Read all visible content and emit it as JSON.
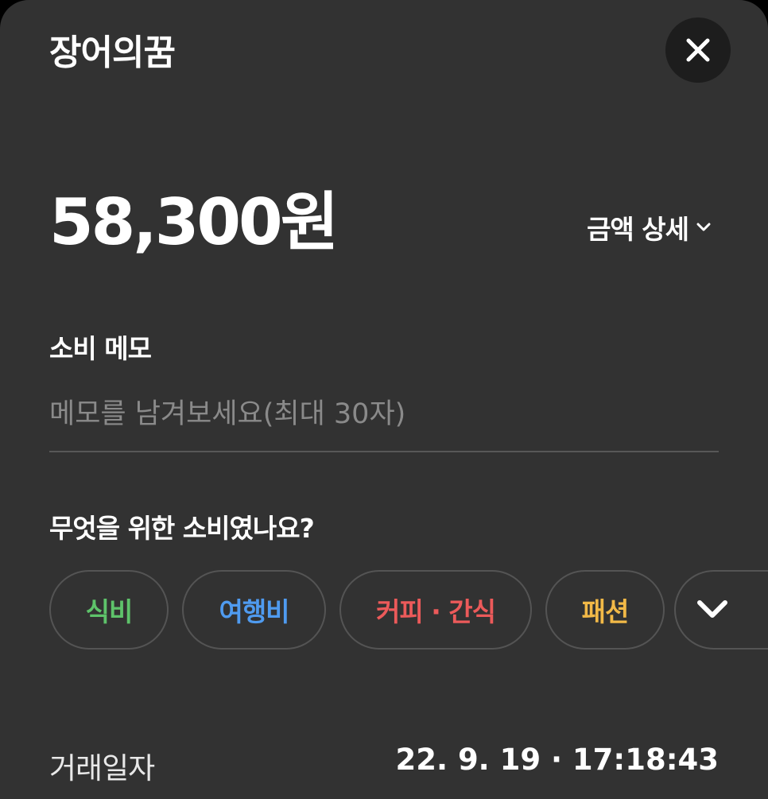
{
  "header": {
    "merchant_name": "장어의꿈",
    "close_icon": "close-icon"
  },
  "amount": {
    "value": "58,300원",
    "detail_label": "금액 상세",
    "detail_icon": "chevron-down-icon"
  },
  "memo": {
    "label": "소비 메모",
    "value": "",
    "placeholder": "메모를 남겨보세요(최대 30자)"
  },
  "category": {
    "question": "무엇을 위한 소비였나요?",
    "chips": [
      {
        "label": "식비",
        "color": "#5ec36a"
      },
      {
        "label": "여행비",
        "color": "#4f9bf0"
      },
      {
        "label": "커피 · 간식",
        "color": "#ec5a5a"
      },
      {
        "label": "패션",
        "color": "#f2b947"
      }
    ],
    "expand_icon": "chevron-down-icon"
  },
  "transaction": {
    "date_label": "거래일자",
    "date_value": "22. 9. 19 · 17:18:43"
  },
  "colors": {
    "sheet_background": "#323232",
    "close_button_background": "#1d1d1d",
    "text_primary": "#ffffff",
    "placeholder": "#8a8a8a"
  }
}
